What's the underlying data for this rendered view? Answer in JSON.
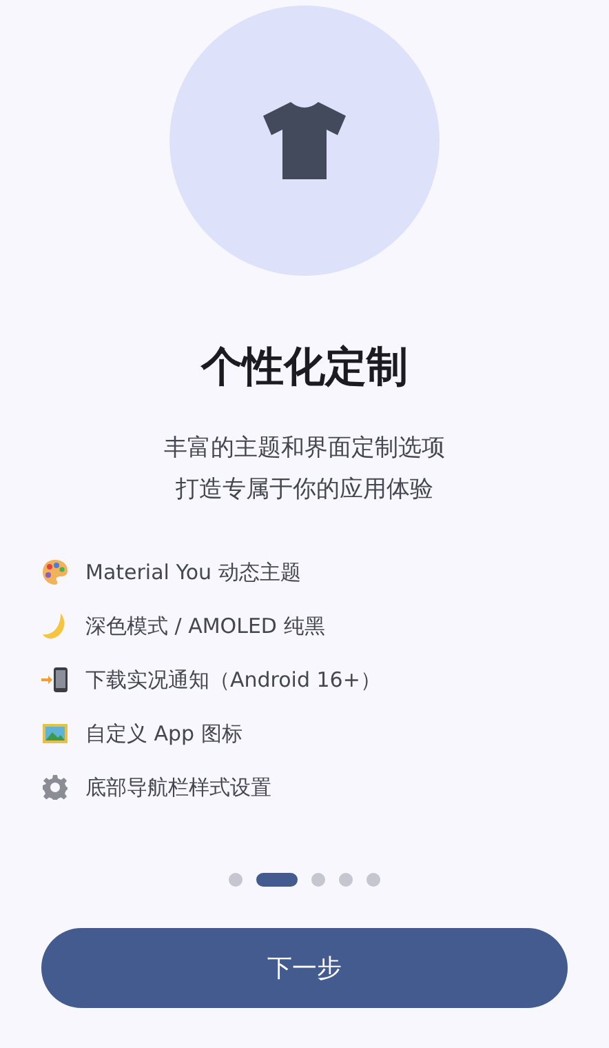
{
  "title": "个性化定制",
  "subtitle_lines": [
    "丰富的主题和界面定制选项",
    "打造专属于你的应用体验"
  ],
  "features": [
    {
      "kind": "palette",
      "label": "Material You 动态主题"
    },
    {
      "kind": "moon",
      "label": "深色模式 / AMOLED 纯黑"
    },
    {
      "kind": "phone",
      "label": "下载实况通知（Android 16+）"
    },
    {
      "kind": "image",
      "label": "自定义 App 图标"
    },
    {
      "kind": "gear",
      "label": "底部导航栏样式设置"
    }
  ],
  "page_indicator": [
    {
      "selected": false
    },
    {
      "selected": true
    },
    {
      "selected": false
    },
    {
      "selected": false
    },
    {
      "selected": false
    }
  ],
  "next_button": "下一步"
}
